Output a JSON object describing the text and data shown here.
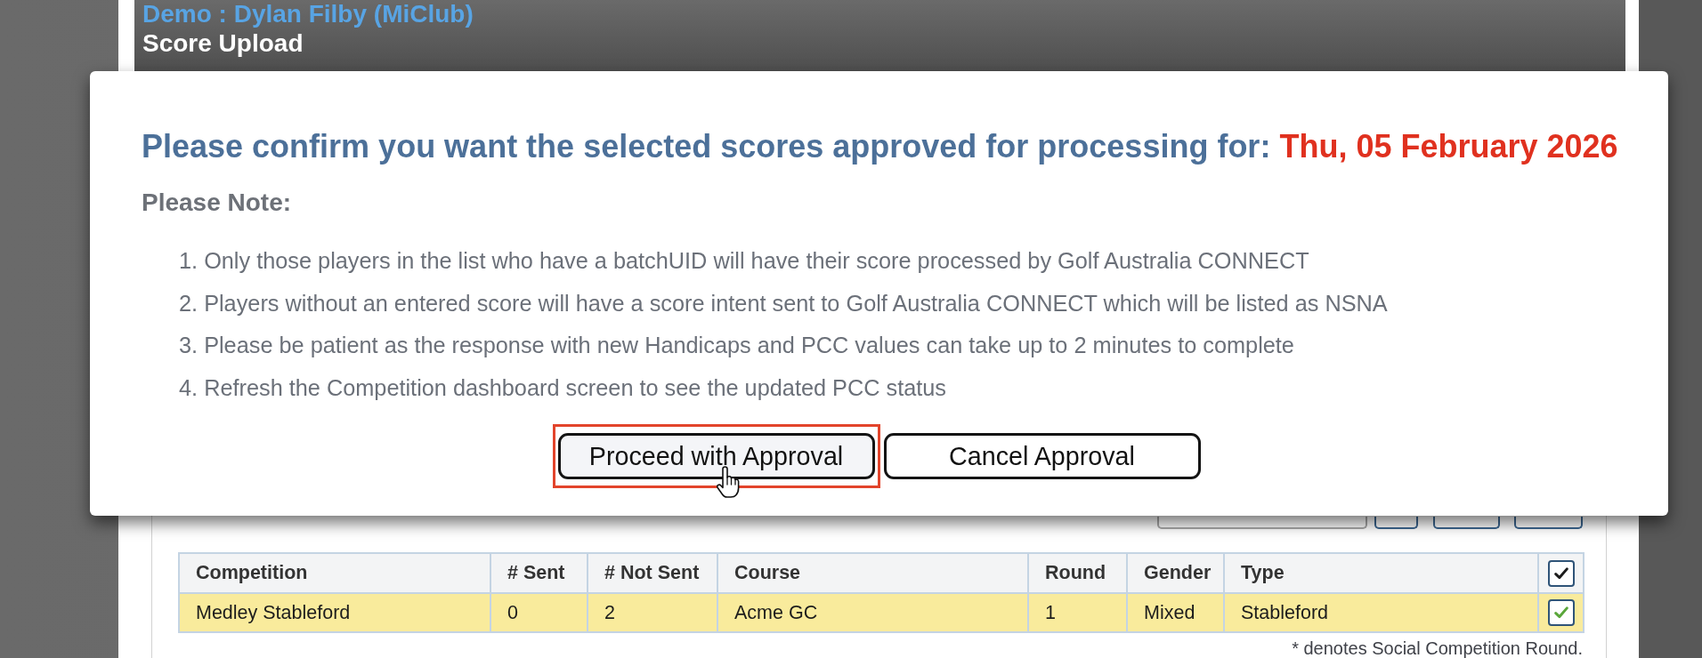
{
  "header": {
    "account": "Demo : Dylan Filby (MiClub)",
    "page_title": "Score Upload"
  },
  "dialog": {
    "heading": "Please confirm you want the selected scores approved for processing for:",
    "date": "Thu, 05 February 2026",
    "note_title": "Please Note:",
    "notes": [
      "1. Only those players in the list who have a batchUID will have their score processed by Golf Australia CONNECT",
      "2. Players without an entered score will have a score intent sent to Golf Australia CONNECT which will be listed as NSNA",
      "3. Please be patient as the response with new Handicaps and PCC values can take up to 2 minutes to complete",
      "4. Refresh the Competition dashboard screen to see the updated PCC status"
    ],
    "buttons": [
      {
        "label": "Proceed with Approval",
        "hovered": true,
        "highlighted": true
      },
      {
        "label": "Cancel Approval",
        "hovered": false,
        "highlighted": false
      }
    ]
  },
  "table": {
    "columns": [
      "Competition",
      "# Sent",
      "# Not Sent",
      "Course",
      "Round",
      "Gender",
      "Type"
    ],
    "select_all": {
      "checked": true
    },
    "rows": [
      {
        "cells": [
          "Medley Stableford",
          "0",
          "2",
          "Acme GC",
          "1",
          "Mixed",
          "Stableford"
        ],
        "selected": true,
        "checked": true
      }
    ]
  },
  "footnote": "* denotes Social Competition Round."
}
